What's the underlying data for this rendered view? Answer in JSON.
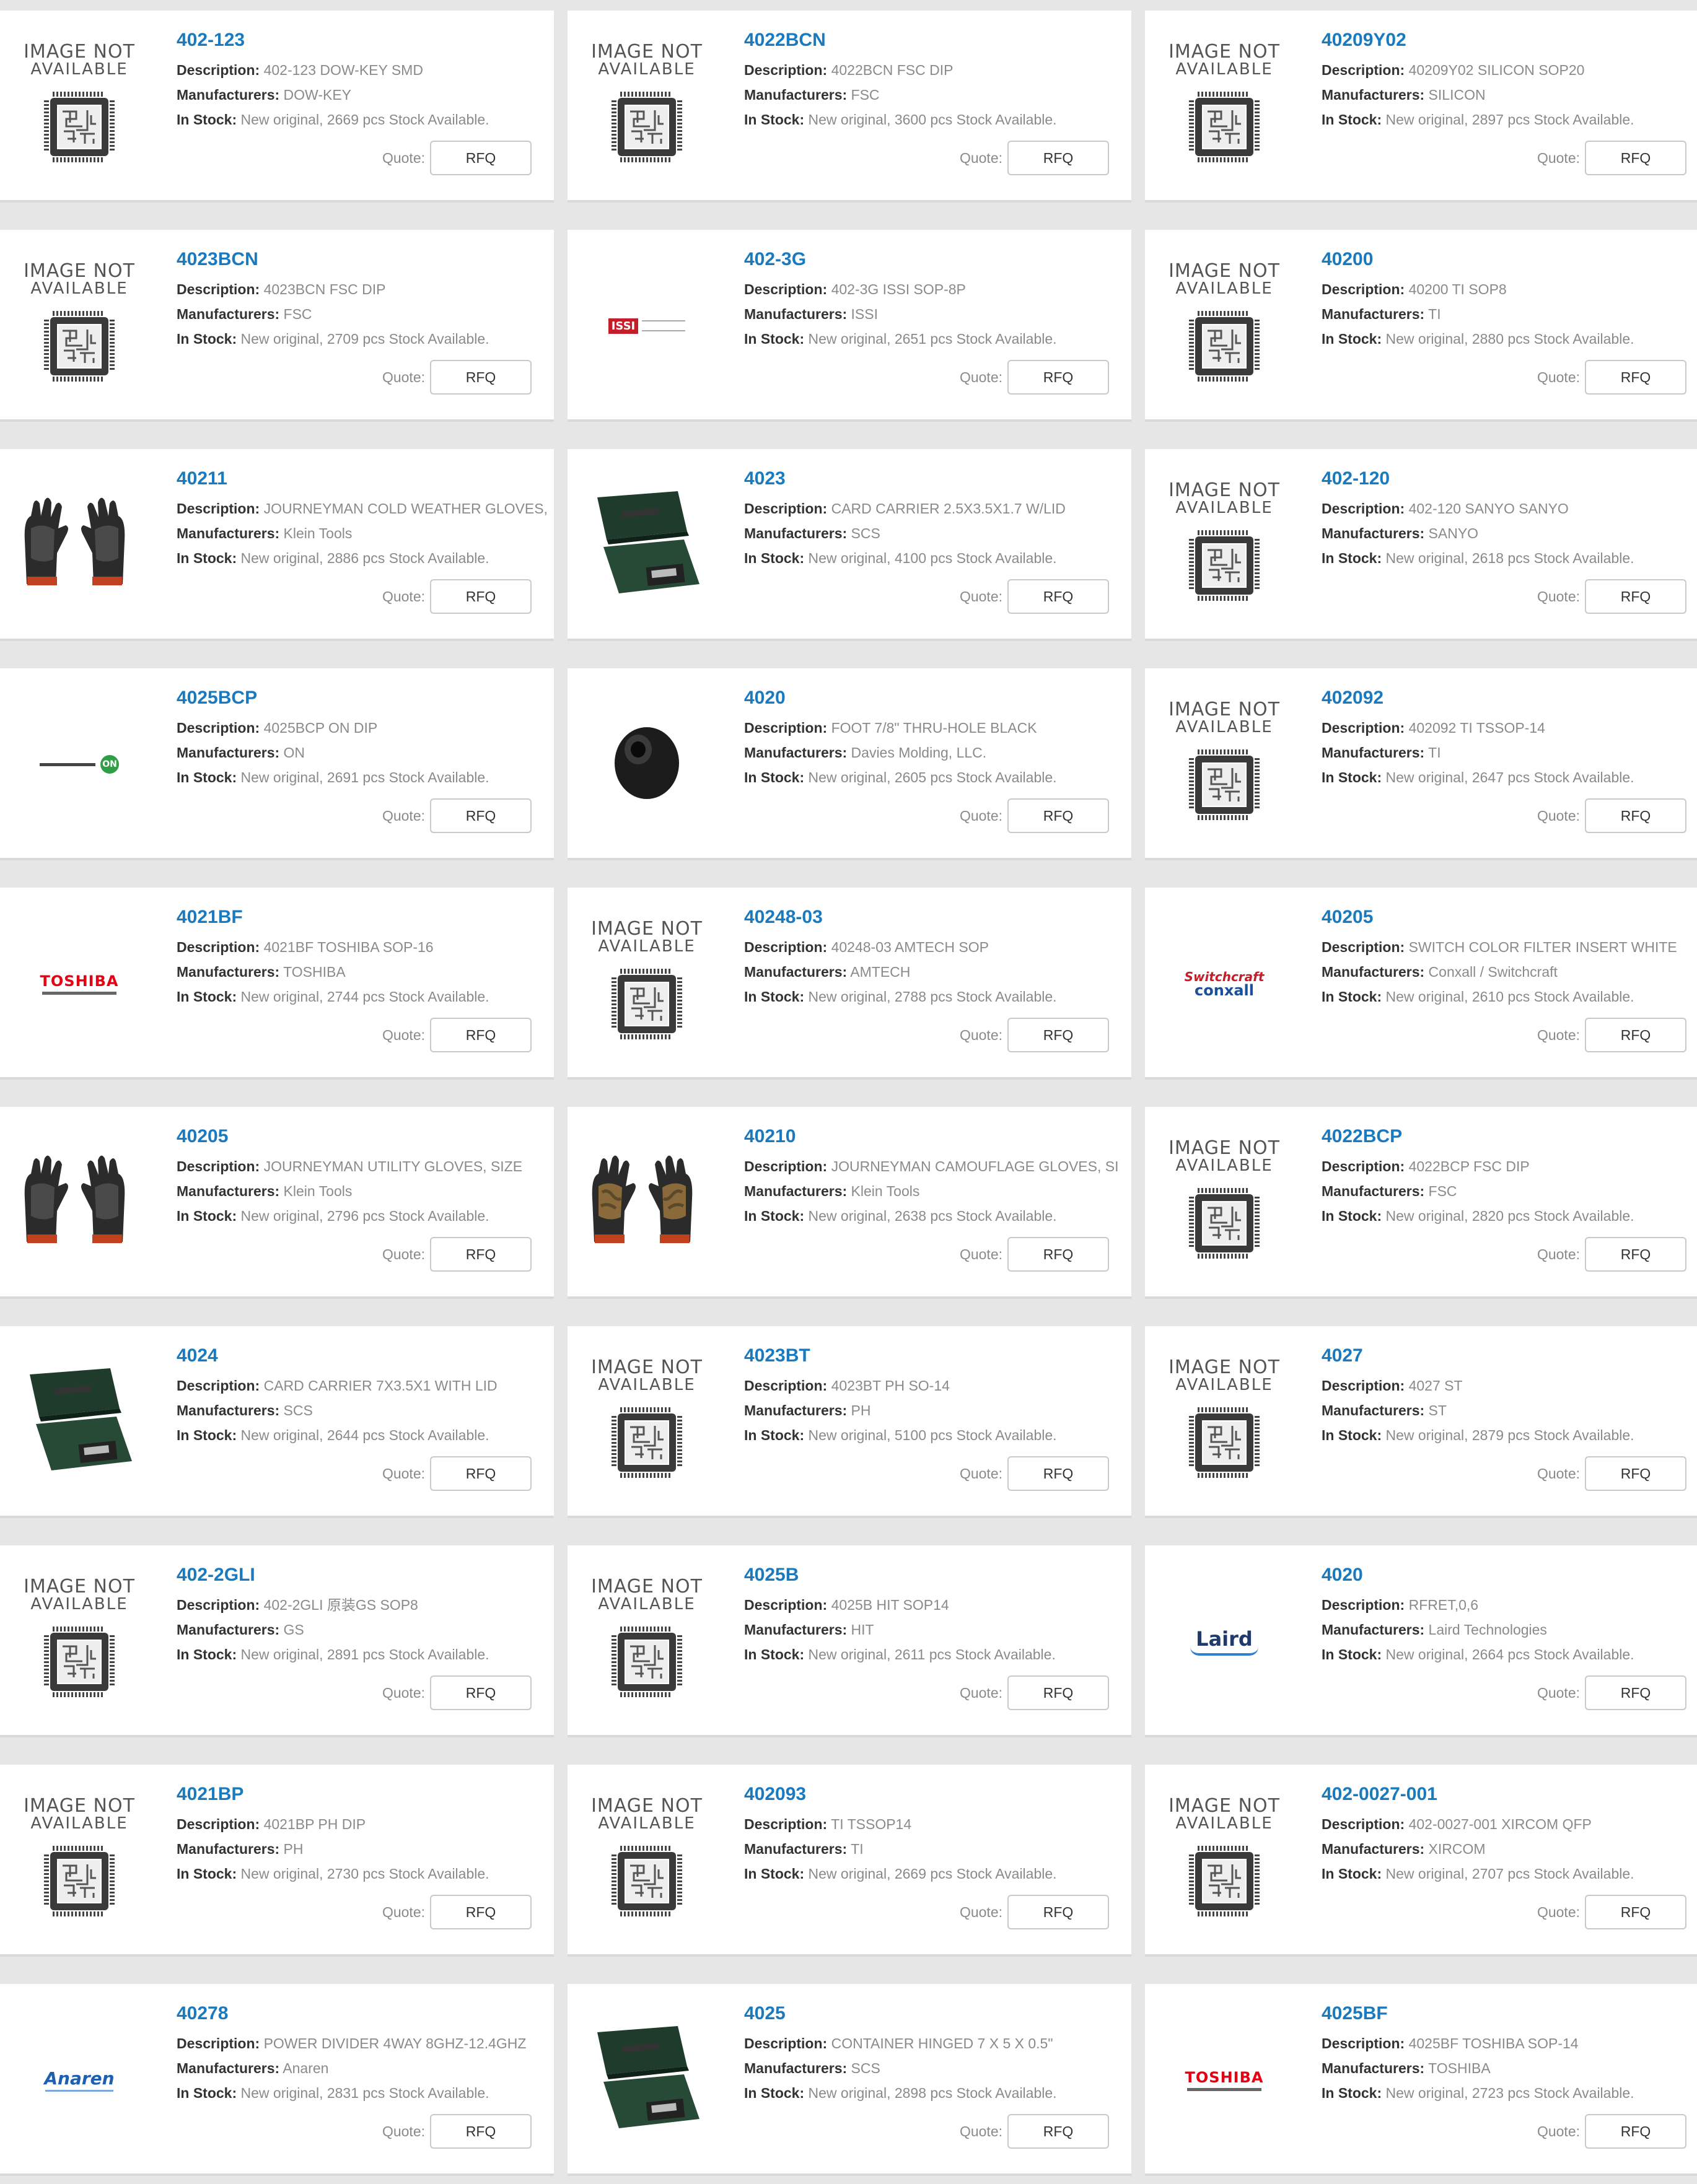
{
  "labels": {
    "description": "Description:",
    "manufacturers": "Manufacturers:",
    "in_stock": "In Stock:",
    "quote": "Quote:",
    "rfq": "RFQ",
    "na_line1": "IMAGE NOT",
    "na_line2": "AVAILABLE"
  },
  "colors": {
    "part_link": "#1a7abf",
    "background": "#e6e6e6"
  },
  "products": [
    {
      "pn": "402-123",
      "desc": "402-123 DOW-KEY SMD",
      "mfr": "DOW-KEY",
      "stock": "New original, 2669 pcs Stock Available.",
      "img": "na"
    },
    {
      "pn": "4022BCN",
      "desc": "4022BCN FSC DIP",
      "mfr": "FSC",
      "stock": "New original, 3600 pcs Stock Available.",
      "img": "na"
    },
    {
      "pn": "40209Y02",
      "desc": "40209Y02 SILICON SOP20",
      "mfr": "SILICON",
      "stock": "New original, 2897 pcs Stock Available.",
      "img": "na"
    },
    {
      "pn": "4023BCN",
      "desc": "4023BCN FSC DIP",
      "mfr": "FSC",
      "stock": "New original, 2709 pcs Stock Available.",
      "img": "na"
    },
    {
      "pn": "402-3G",
      "desc": "402-3G ISSI SOP-8P",
      "mfr": "ISSI",
      "stock": "New original, 2651 pcs Stock Available.",
      "img": "issi",
      "logo": "ISSI"
    },
    {
      "pn": "40200",
      "desc": "40200 TI SOP8",
      "mfr": "TI",
      "stock": "New original, 2880 pcs Stock Available.",
      "img": "na"
    },
    {
      "pn": "40211",
      "desc": "JOURNEYMAN COLD WEATHER GLOVES,",
      "mfr": "Klein Tools",
      "stock": "New original, 2886 pcs Stock Available.",
      "img": "gloves"
    },
    {
      "pn": "4023",
      "desc": "CARD CARRIER 2.5X3.5X1.7 W/LID",
      "mfr": "SCS",
      "stock": "New original, 4100 pcs Stock Available.",
      "img": "box"
    },
    {
      "pn": "402-120",
      "desc": "402-120 SANYO SANYO",
      "mfr": "SANYO",
      "stock": "New original, 2618 pcs Stock Available.",
      "img": "na"
    },
    {
      "pn": "4025BCP",
      "desc": "4025BCP ON DIP",
      "mfr": "ON",
      "stock": "New original, 2691 pcs Stock Available.",
      "img": "on",
      "logo": "ON"
    },
    {
      "pn": "4020",
      "desc": "FOOT 7/8\" THRU-HOLE BLACK",
      "mfr": "Davies Molding, LLC.",
      "stock": "New original, 2605 pcs Stock Available.",
      "img": "foot"
    },
    {
      "pn": "402092",
      "desc": "402092 TI TSSOP-14",
      "mfr": "TI",
      "stock": "New original, 2647 pcs Stock Available.",
      "img": "na"
    },
    {
      "pn": "4021BF",
      "desc": "4021BF TOSHIBA SOP-16",
      "mfr": "TOSHIBA",
      "stock": "New original, 2744 pcs Stock Available.",
      "img": "toshiba",
      "logo": "TOSHIBA"
    },
    {
      "pn": "40248-03",
      "desc": "40248-03 AMTECH SOP",
      "mfr": "AMTECH",
      "stock": "New original, 2788 pcs Stock Available.",
      "img": "na"
    },
    {
      "pn": "40205",
      "desc": "SWITCH COLOR FILTER INSERT WHITE",
      "mfr": "Conxall / Switchcraft",
      "stock": "New original, 2610 pcs Stock Available.",
      "img": "switchcraft",
      "logo": "Switchcraft",
      "logo2": "conxall"
    },
    {
      "pn": "40205",
      "desc": "JOURNEYMAN UTILITY GLOVES, SIZE",
      "mfr": "Klein Tools",
      "stock": "New original, 2796 pcs Stock Available.",
      "img": "gloves"
    },
    {
      "pn": "40210",
      "desc": "JOURNEYMAN CAMOUFLAGE GLOVES, SI",
      "mfr": "Klein Tools",
      "stock": "New original, 2638 pcs Stock Available.",
      "img": "gloves-camo"
    },
    {
      "pn": "4022BCP",
      "desc": "4022BCP FSC DIP",
      "mfr": "FSC",
      "stock": "New original, 2820 pcs Stock Available.",
      "img": "na"
    },
    {
      "pn": "4024",
      "desc": "CARD CARRIER 7X3.5X1 WITH LID",
      "mfr": "SCS",
      "stock": "New original, 2644 pcs Stock Available.",
      "img": "box"
    },
    {
      "pn": "4023BT",
      "desc": "4023BT PH SO-14",
      "mfr": "PH",
      "stock": "New original, 5100 pcs Stock Available.",
      "img": "na"
    },
    {
      "pn": "4027",
      "desc": "4027 ST",
      "mfr": "ST",
      "stock": "New original, 2879 pcs Stock Available.",
      "img": "na"
    },
    {
      "pn": "402-2GLI",
      "desc": "402-2GLI 原装GS SOP8",
      "mfr": "GS",
      "stock": "New original, 2891 pcs Stock Available.",
      "img": "na"
    },
    {
      "pn": "4025B",
      "desc": "4025B HIT SOP14",
      "mfr": "HIT",
      "stock": "New original, 2611 pcs Stock Available.",
      "img": "na"
    },
    {
      "pn": "4020",
      "desc": "RFRET,0,6",
      "mfr": "Laird Technologies",
      "stock": "New original, 2664 pcs Stock Available.",
      "img": "laird",
      "logo": "Laird"
    },
    {
      "pn": "4021BP",
      "desc": "4021BP PH DIP",
      "mfr": "PH",
      "stock": "New original, 2730 pcs Stock Available.",
      "img": "na"
    },
    {
      "pn": "402093",
      "desc": "TI TSSOP14",
      "mfr": "TI",
      "stock": "New original, 2669 pcs Stock Available.",
      "img": "na"
    },
    {
      "pn": "402-0027-001",
      "desc": "402-0027-001 XIRCOM QFP",
      "mfr": "XIRCOM",
      "stock": "New original, 2707 pcs Stock Available.",
      "img": "na"
    },
    {
      "pn": "40278",
      "desc": "POWER DIVIDER 4WAY 8GHZ-12.4GHZ",
      "mfr": "Anaren",
      "stock": "New original, 2831 pcs Stock Available.",
      "img": "anaren",
      "logo": "Anaren"
    },
    {
      "pn": "4025",
      "desc": "CONTAINER HINGED 7 X 5 X 0.5\"",
      "mfr": "SCS",
      "stock": "New original, 2898 pcs Stock Available.",
      "img": "box"
    },
    {
      "pn": "4025BF",
      "desc": "4025BF TOSHIBA SOP-14",
      "mfr": "TOSHIBA",
      "stock": "New original, 2723 pcs Stock Available.",
      "img": "toshiba",
      "logo": "TOSHIBA"
    }
  ]
}
